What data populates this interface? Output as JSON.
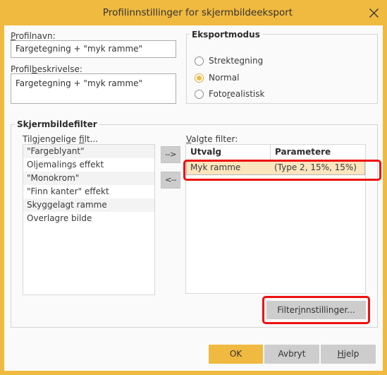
{
  "window": {
    "title": "Profilinnstillinger for skjermbildeeksport",
    "close_icon": "close-icon",
    "frame_color": "#f0b93f",
    "titlebar_color": "#f0b93f"
  },
  "profile": {
    "name_label_pre": "",
    "name_label_accel": "P",
    "name_label_post": "rofilnavn:",
    "name_value": "Fargetegning + \"myk ramme\"",
    "description_label_pre": "Profil",
    "description_label_accel": "b",
    "description_label_post": "eskrivelse:",
    "description_value": "Fargetegning + \"myk ramme\""
  },
  "export_mode": {
    "title": "Eksportmodus",
    "options": [
      {
        "label_pre": "Strekte",
        "label_accel": "g",
        "label_post": "ning",
        "label": "Strektegning",
        "selected": false
      },
      {
        "label_pre": "Normal",
        "label_accel": "",
        "label_post": "",
        "label": "Normal",
        "selected": true
      },
      {
        "label_pre": "Foto",
        "label_accel": "r",
        "label_post": "ealistisk",
        "label": "Fotorealistisk",
        "selected": false
      }
    ],
    "selected_value": "Normal",
    "accent_color": "#f0b93f"
  },
  "filters": {
    "group_title": "Skjermbildefilter",
    "available_label_pre": "Tilgjengelige ",
    "available_label_accel": "fi",
    "available_label_post": "lt...",
    "available_label": "Tilgjengelige filt...",
    "available_items": [
      "\"Fargeblyant\"",
      "Oljemalings effekt",
      "\"Monokrom\"",
      "\"Finn kanter\" effekt",
      "Skyggelagt ramme",
      "Overlagre bilde"
    ],
    "add_button": "-->",
    "remove_button": "<--",
    "selected_label_pre": "",
    "selected_label_accel": "V",
    "selected_label_post": "algte filter:",
    "selected_label": "Valgte filter:",
    "columns": [
      "Utvalg",
      "Parametere"
    ],
    "selected_rows": [
      {
        "utvalg": "Myk ramme",
        "parametere": "(Type 2, 15%, 15%)",
        "selected": true
      }
    ],
    "selected_row_color": "#fae5bd",
    "settings_button_pre": "Filter",
    "settings_button_accel": "i",
    "settings_button_post": "nnstillinger...",
    "settings_button": "Filterinnstillinger..."
  },
  "footer": {
    "ok_label": "OK",
    "cancel_label": "Avbryt",
    "help_label_pre": "",
    "help_label_accel": "H",
    "help_label_post": "jelp",
    "help_label": "Hjelp",
    "ok_color": "#f0b93f"
  },
  "annotations": {
    "highlight_color": "#ee1111",
    "count": 2
  }
}
